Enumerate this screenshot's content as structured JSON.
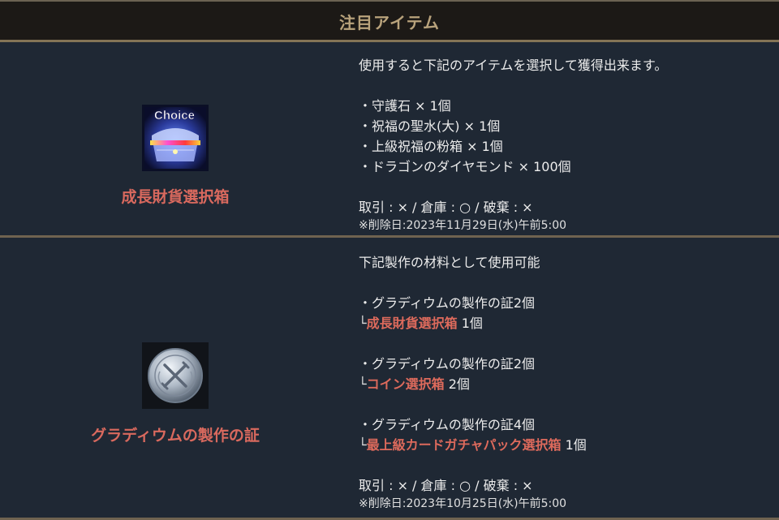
{
  "header": {
    "title": "注目アイテム"
  },
  "items": [
    {
      "name": "成長財貨選択箱",
      "icon_text": "Choice",
      "description": "使用すると下記のアイテムを選択して獲得出来ます。",
      "list": [
        "・守護石 × 1個",
        "・祝福の聖水(大) × 1個",
        "・上級祝福の粉箱 × 1個",
        "・ドラゴンのダイヤモンド × 100個"
      ],
      "trade": "取引 : × / 倉庫 : ○ / 破棄 : ×",
      "deletion": "※削除日:2023年11月29日(水)午前5:00"
    },
    {
      "name": "グラディウムの製作の証",
      "description": "下記製作の材料として使用可能",
      "recipes": [
        {
          "line": "・グラディウムの製作の証2個",
          "branch": "└",
          "target": "成長財貨選択箱",
          "qty": " 1個"
        },
        {
          "line": "・グラディウムの製作の証2個",
          "branch": "└",
          "target": "コイン選択箱",
          "qty": " 2個"
        },
        {
          "line": "・グラディウムの製作の証4個",
          "branch": "└",
          "target": "最上級カードガチャパック選択箱",
          "qty": " 1個"
        }
      ],
      "trade": "取引 : × / 倉庫 : ○ / 破棄 : ×",
      "deletion": "※削除日:2023年10月25日(水)午前5:00"
    }
  ]
}
